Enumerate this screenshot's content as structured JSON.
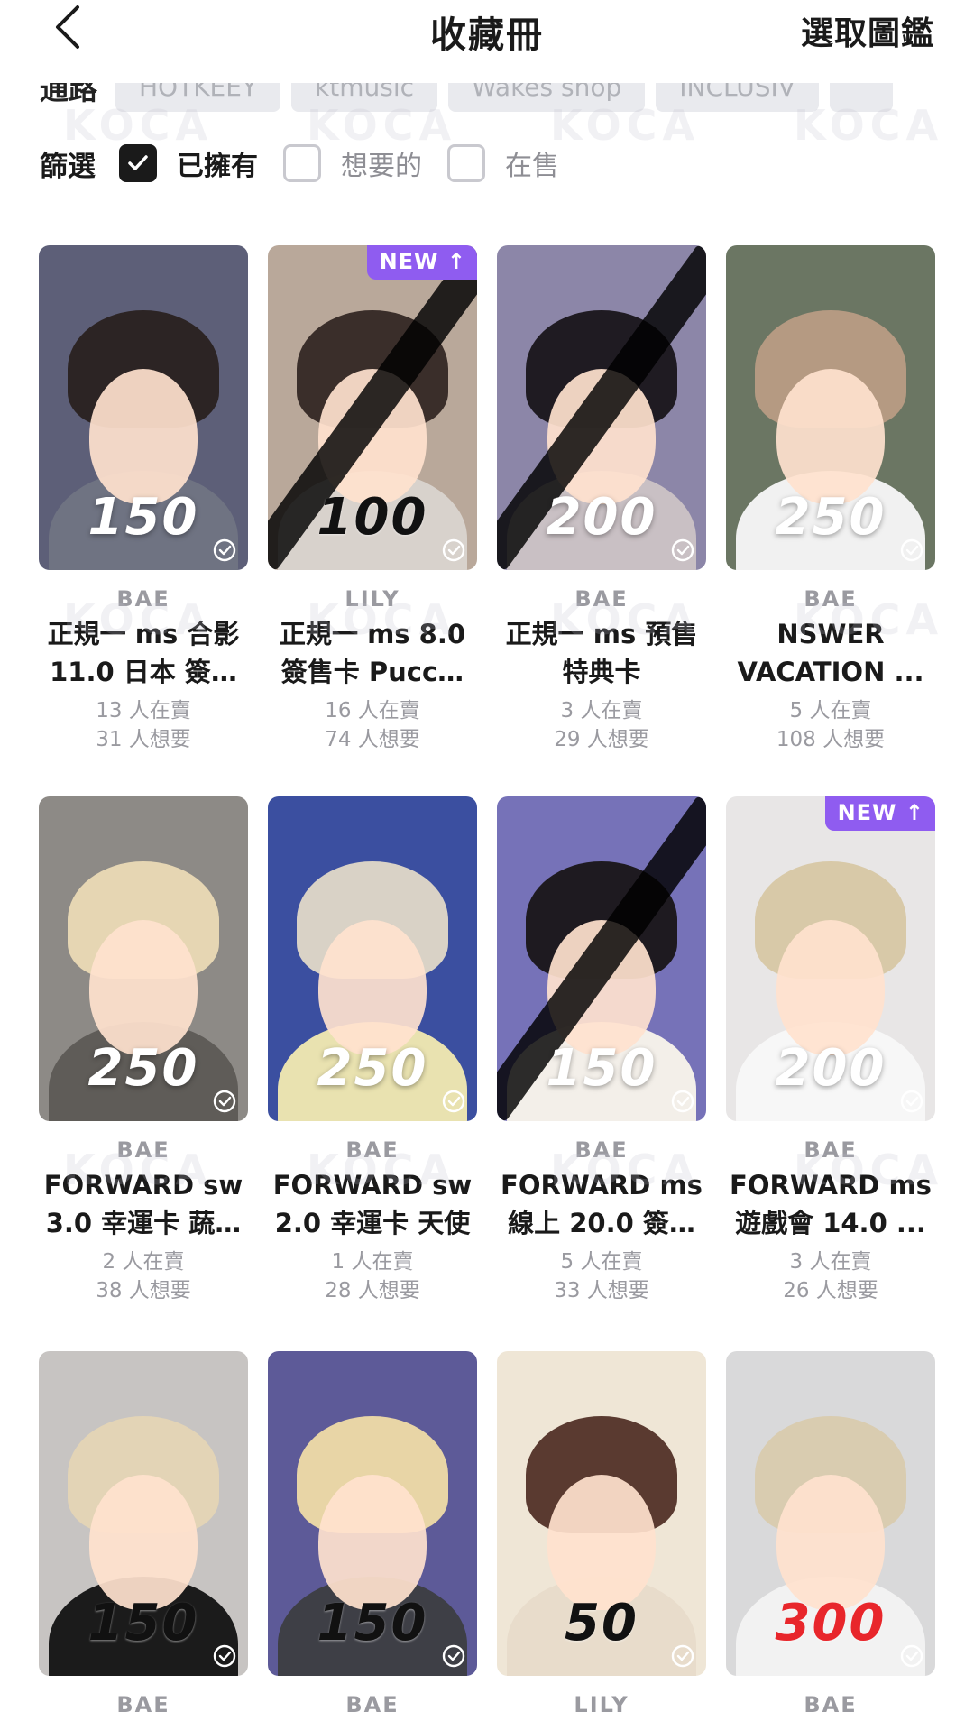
{
  "header": {
    "title": "收藏冊",
    "select_guide": "選取圖鑑"
  },
  "shop_filter": {
    "label": "通路",
    "chips": [
      "HOTKEEY",
      "ktmusic",
      "Wakes shop",
      "INCLUSIV",
      ""
    ]
  },
  "filters": {
    "label": "篩選",
    "options": [
      {
        "label": "已擁有",
        "checked": true
      },
      {
        "label": "想要的",
        "checked": false
      },
      {
        "label": "在售",
        "checked": false
      }
    ]
  },
  "watermark": "KOCA",
  "cards": [
    {
      "price": "150",
      "member": "BAE",
      "title": "正規一 ms 合影\n11.0 日本 簽…",
      "stats": "13 人在賣\n31 人想要",
      "is_new": false,
      "crossed": false,
      "price_style": "light",
      "bg": "#5d5f78",
      "hair": "#2c2424",
      "body": "#6f7382"
    },
    {
      "price": "100",
      "member": "LILY",
      "title": "正規一 ms 8.0\n簽售卡 Pucc…",
      "stats": "16 人在賣\n74 人想要",
      "is_new": true,
      "new_label": "NEW",
      "crossed": true,
      "price_style": "dark",
      "bg": "#b9a89a",
      "hair": "#3a2e2a",
      "body": "#d8d2cc"
    },
    {
      "price": "200",
      "member": "BAE",
      "title": "正規一 ms 預售\n特典卡",
      "stats": "3 人在賣\n29 人想要",
      "is_new": false,
      "crossed": true,
      "price_style": "light",
      "bg": "#8c86a8",
      "hair": "#1f1b22",
      "body": "#c9c0c4"
    },
    {
      "price": "250",
      "member": "BAE",
      "title": "NSWER\nVACATION ...",
      "stats": "5 人在賣\n108 人想要",
      "is_new": false,
      "crossed": false,
      "price_style": "light",
      "bg": "#6b7663",
      "hair": "#b59a82",
      "body": "#f1f1f1"
    },
    {
      "price": "250",
      "member": "BAE",
      "title": "FORWARD sw\n3.0 幸運卡 蔬…",
      "stats": "2 人在賣\n38 人想要",
      "is_new": false,
      "crossed": false,
      "price_style": "light",
      "bg": "#8d8a86",
      "hair": "#e6d6b3",
      "body": "#5f5c58"
    },
    {
      "price": "250",
      "member": "BAE",
      "title": "FORWARD sw\n2.0 幸運卡 天使",
      "stats": "1 人在賣\n28 人想要",
      "is_new": false,
      "crossed": false,
      "price_style": "light",
      "bg": "#3b4fa0",
      "hair": "#d9d2c6",
      "body": "#e9e2b0"
    },
    {
      "price": "150",
      "member": "BAE",
      "title": "FORWARD ms\n線上 20.0 簽…",
      "stats": "5 人在賣\n33 人想要",
      "is_new": false,
      "crossed": true,
      "price_style": "light",
      "bg": "#7672b8",
      "hair": "#1e1a20",
      "body": "#f3efe9"
    },
    {
      "price": "200",
      "member": "BAE",
      "title": "FORWARD ms\n遊戲會 14.0 ...",
      "stats": "3 人在賣\n26 人想要",
      "is_new": true,
      "new_label": "NEW",
      "crossed": false,
      "price_style": "light",
      "bg": "#e8e6e6",
      "hair": "#d8c9a8",
      "body": "#f7f7f7"
    },
    {
      "price": "150",
      "member": "BAE",
      "title": "",
      "stats": "",
      "is_new": false,
      "crossed": false,
      "price_style": "dark",
      "bg": "#c7c4c2",
      "hair": "#e3d4b6",
      "body": "#1b1b1b"
    },
    {
      "price": "150",
      "member": "BAE",
      "title": "",
      "stats": "",
      "is_new": false,
      "crossed": false,
      "price_style": "dark",
      "bg": "#5d5a98",
      "hair": "#e8d5a6",
      "body": "#3e3f46"
    },
    {
      "price": "50",
      "member": "LILY",
      "title": "",
      "stats": "",
      "is_new": false,
      "crossed": false,
      "price_style": "dark",
      "bg": "#efe6d6",
      "hair": "#5a3a30",
      "body": "#e8dccb"
    },
    {
      "price": "300",
      "member": "BAE",
      "title": "",
      "stats": "",
      "is_new": false,
      "crossed": false,
      "price_style": "red",
      "bg": "#d9d9da",
      "hair": "#d9ccb0",
      "body": "#f2f2f2"
    }
  ]
}
